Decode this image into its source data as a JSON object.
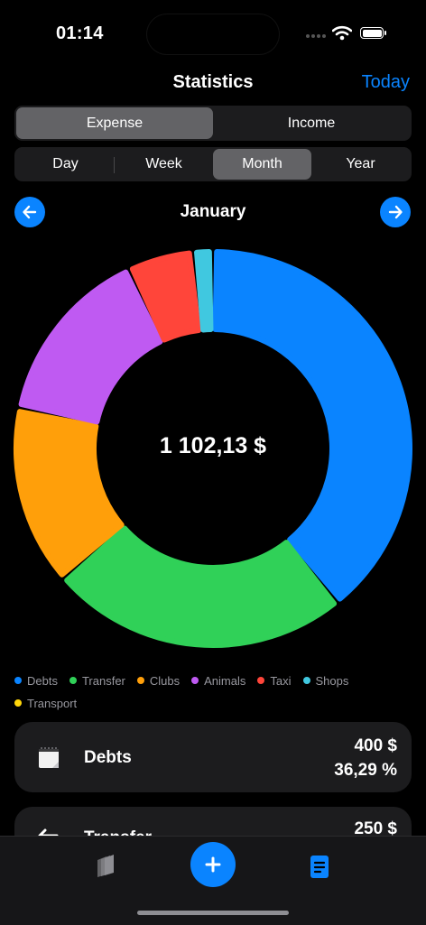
{
  "status_bar": {
    "time": "01:14"
  },
  "header": {
    "title": "Statistics",
    "today_label": "Today"
  },
  "type_toggle": {
    "options": [
      "Expense",
      "Income"
    ],
    "selected": "Expense"
  },
  "period_toggle": {
    "options": [
      "Day",
      "Week",
      "Month",
      "Year"
    ],
    "selected": "Month"
  },
  "period": {
    "label": "January"
  },
  "summary": {
    "total": "1 102,13 $"
  },
  "chart_data": {
    "type": "pie",
    "categories": [
      "Debts",
      "Transfer",
      "Clubs",
      "Animals",
      "Taxi",
      "Shops",
      "Transport"
    ],
    "values": [
      36.29,
      22.68,
      13.61,
      13.61,
      5.0,
      1.5,
      0
    ],
    "colors": [
      "#0a84ff",
      "#30d158",
      "#ff9f0a",
      "#bf5af2",
      "#ff453a",
      "#40c8e0",
      "#ffd60a"
    ],
    "unit": "%",
    "legend_position": "bottom",
    "inner_label": "1 102,13 $"
  },
  "legend": [
    {
      "label": "Debts",
      "color": "#0a84ff"
    },
    {
      "label": "Transfer",
      "color": "#30d158"
    },
    {
      "label": "Clubs",
      "color": "#ff9f0a"
    },
    {
      "label": "Animals",
      "color": "#bf5af2"
    },
    {
      "label": "Taxi",
      "color": "#ff453a"
    },
    {
      "label": "Shops",
      "color": "#40c8e0"
    },
    {
      "label": "Transport",
      "color": "#ffd60a"
    }
  ],
  "cards": [
    {
      "name": "Debts",
      "amount": "400 $",
      "percent": "36,29 %",
      "icon": "notepad-icon"
    },
    {
      "name": "Transfer",
      "amount": "250 $",
      "percent": "",
      "icon": "transfer-arrow-icon"
    }
  ],
  "tab_bar": {
    "items": [
      "wallets-icon",
      "add-icon",
      "statistics-report-icon"
    ],
    "active": "statistics-report-icon"
  }
}
